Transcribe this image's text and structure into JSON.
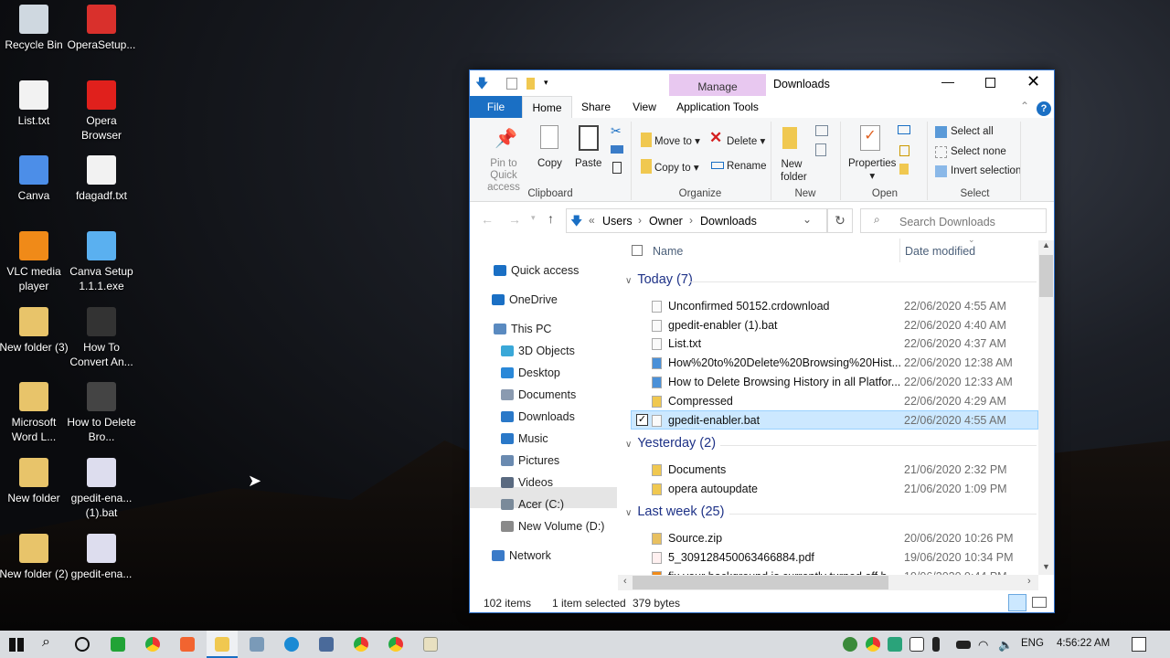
{
  "desktop": {
    "icons": [
      {
        "label": "Recycle Bin",
        "color": "#cfd8e0"
      },
      {
        "label": "OperaSetup...",
        "color": "#d9302c"
      },
      {
        "label": "List.txt",
        "color": "#f2f2f2"
      },
      {
        "label": "Opera Browser",
        "color": "#e0201c"
      },
      {
        "label": "Canva",
        "color": "#4c8ee8"
      },
      {
        "label": "fdagadf.txt",
        "color": "#f2f2f2"
      },
      {
        "label": "VLC media player",
        "color": "#f08a18"
      },
      {
        "label": "Canva Setup 1.1.1.exe",
        "color": "#5ab0f0"
      },
      {
        "label": "New folder (3)",
        "color": "#e8c46a"
      },
      {
        "label": "How To Convert An...",
        "color": "#333"
      },
      {
        "label": "Microsoft Word L...",
        "color": "#e8c46a"
      },
      {
        "label": "How to Delete Bro...",
        "color": "#444"
      },
      {
        "label": "New folder",
        "color": "#e8c46a"
      },
      {
        "label": "gpedit-ena... (1).bat",
        "color": "#dde"
      },
      {
        "label": "New folder (2)",
        "color": "#e8c46a"
      },
      {
        "label": "gpedit-ena...",
        "color": "#dde"
      }
    ]
  },
  "window": {
    "title": "Downloads",
    "context_tab": "Manage",
    "tabs": [
      "File",
      "Home",
      "Share",
      "View",
      "Application Tools"
    ],
    "ribbon": {
      "pin": "Pin to Quick access",
      "copy": "Copy",
      "paste": "Paste",
      "move_to": "Move to",
      "copy_to": "Copy to",
      "delete": "Delete",
      "rename": "Rename",
      "new_folder": "New folder",
      "properties": "Properties",
      "select_all": "Select all",
      "select_none": "Select none",
      "invert_selection": "Invert selection",
      "groups": [
        "Clipboard",
        "Organize",
        "New",
        "Open",
        "Select"
      ]
    },
    "breadcrumb": [
      "Users",
      "Owner",
      "Downloads"
    ],
    "search_placeholder": "Search Downloads",
    "nav": [
      "Quick access",
      "OneDrive",
      "This PC",
      "3D Objects",
      "Desktop",
      "Documents",
      "Downloads",
      "Music",
      "Pictures",
      "Videos",
      "Acer (C:)",
      "New Volume (D:)",
      "Network"
    ],
    "columns": {
      "name": "Name",
      "date": "Date modified"
    },
    "groups": [
      {
        "title": "Today (7)",
        "files": [
          {
            "name": "Unconfirmed 50152.crdownload",
            "date": "22/06/2020 4:55 AM"
          },
          {
            "name": "gpedit-enabler (1).bat",
            "date": "22/06/2020 4:40 AM"
          },
          {
            "name": "List.txt",
            "date": "22/06/2020 4:37 AM"
          },
          {
            "name": "How%20to%20Delete%20Browsing%20Hist...",
            "date": "22/06/2020 12:38 AM"
          },
          {
            "name": "How to Delete Browsing History in all Platfor...",
            "date": "22/06/2020 12:33 AM"
          },
          {
            "name": "Compressed",
            "date": "22/06/2020 4:29 AM"
          },
          {
            "name": "gpedit-enabler.bat",
            "date": "22/06/2020 4:55 AM",
            "selected": true
          }
        ]
      },
      {
        "title": "Yesterday (2)",
        "files": [
          {
            "name": "Documents",
            "date": "21/06/2020 2:32 PM"
          },
          {
            "name": "opera autoupdate",
            "date": "21/06/2020 1:09 PM"
          }
        ]
      },
      {
        "title": "Last week (25)",
        "files": [
          {
            "name": "Source.zip",
            "date": "20/06/2020 10:26 PM"
          },
          {
            "name": "5_309128450063466884.pdf",
            "date": "19/06/2020 10:34 PM"
          },
          {
            "name": "fix your background is currently turned off b...",
            "date": "19/06/2020 9:44 PM"
          }
        ]
      }
    ],
    "status": {
      "items": "102 items",
      "selected": "1 item selected",
      "size": "379 bytes"
    }
  },
  "taskbar": {
    "tray": {
      "lang": "ENG",
      "time": "4:56:22 AM"
    }
  },
  "colors": {
    "accent": "#1a6fc4",
    "manage": "#e8c8f0",
    "selection": "#cce8ff"
  }
}
